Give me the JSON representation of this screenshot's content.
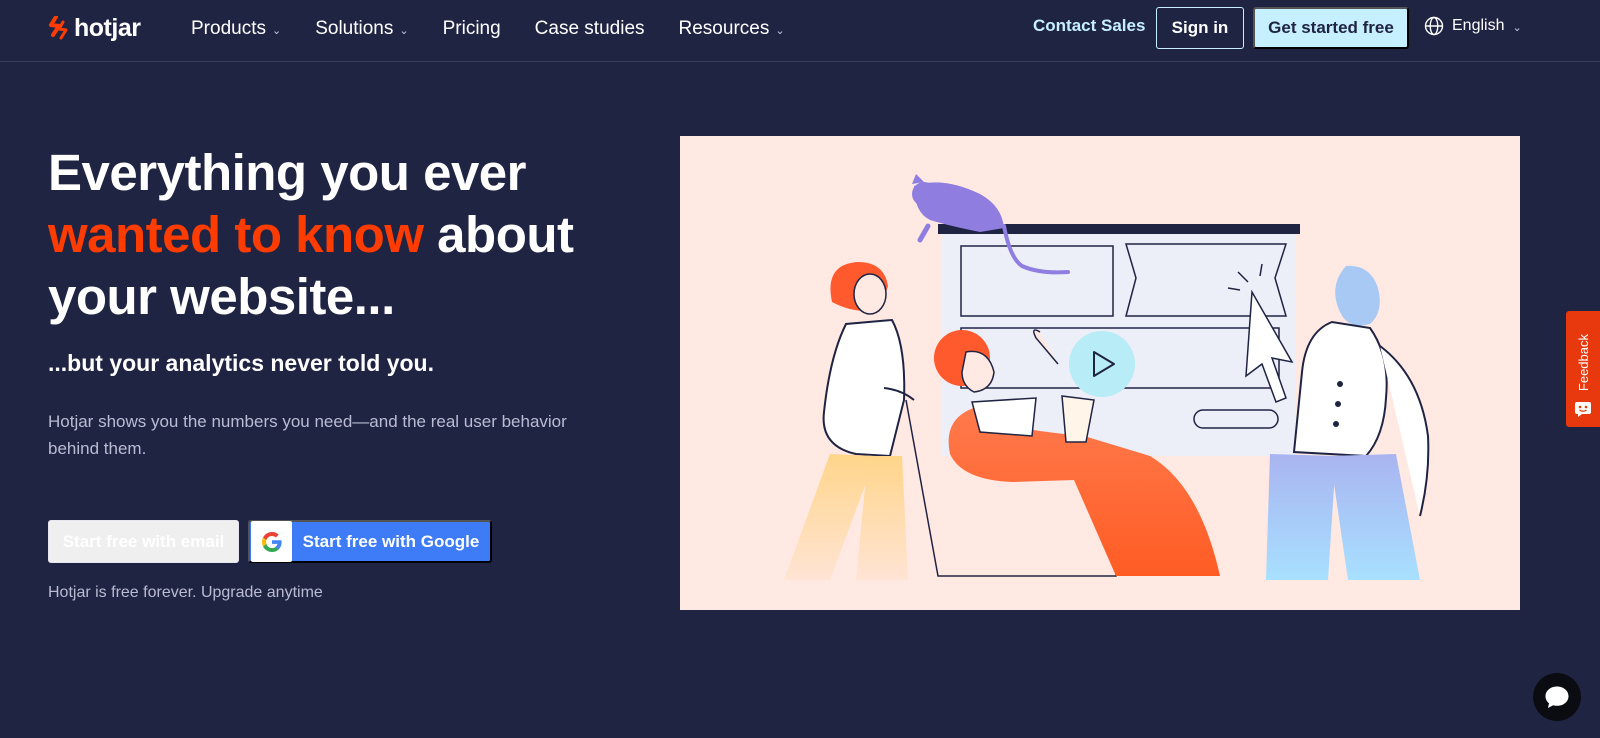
{
  "nav": {
    "logo_text": "hotjar",
    "links": [
      {
        "label": "Products",
        "has_dropdown": true
      },
      {
        "label": "Solutions",
        "has_dropdown": true
      },
      {
        "label": "Pricing",
        "has_dropdown": false
      },
      {
        "label": "Case studies",
        "has_dropdown": false
      },
      {
        "label": "Resources",
        "has_dropdown": true
      }
    ],
    "contact_sales": "Contact Sales",
    "sign_in": "Sign in",
    "get_started": "Get started free",
    "language": "English"
  },
  "hero": {
    "headline_part1": "Everything you ever",
    "headline_accent": "wanted to know",
    "headline_part2": "about your website...",
    "subheadline": "...but your analytics never told you.",
    "description": "Hotjar shows you the numbers you need—and the real user behavior behind them.",
    "cta_email": "Start free with email",
    "cta_google": "Start free with Google",
    "free_note": "Hotjar is free forever. Upgrade anytime"
  },
  "feedback_tab": {
    "label": "Feedback"
  },
  "icons": {
    "logo": "hotjar-flame-icon",
    "globe": "globe-icon",
    "google": "google-g-icon",
    "play": "play-icon",
    "chat": "chat-bubble-icon",
    "feedback": "feedback-face-icon"
  },
  "colors": {
    "background": "#202443",
    "accent_orange": "#ff3c00",
    "light_cyan": "#c6f0ff",
    "google_blue": "#3e7bf7",
    "illustration_bg": "#ffe9e2",
    "feedback_red": "#e8380d"
  }
}
